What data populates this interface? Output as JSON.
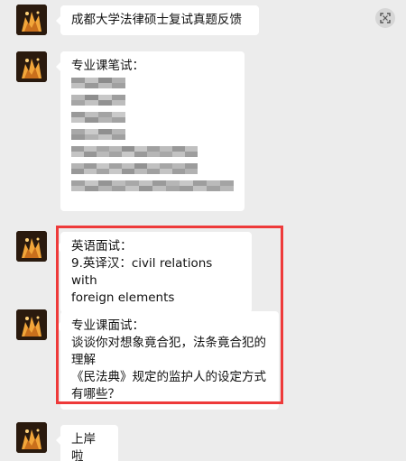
{
  "messages": [
    {
      "lines": [
        "成都大学法律硕士复试真题反馈"
      ]
    },
    {
      "lines": [
        "专业课笔试："
      ]
    },
    {
      "lines": [
        "英语面试：",
        "9.英译汉：civil relations with",
        "foreign elements"
      ]
    },
    {
      "lines": [
        "专业课面试：",
        "谈谈你对想象竟合犯，法条竟合犯的",
        "理解",
        "《民法典》规定的监护人的设定方式",
        "有哪些？"
      ]
    },
    {
      "lines": [
        "上岸啦"
      ]
    }
  ],
  "icons": {
    "avatar": "avatar-image",
    "expand": "expand-icon"
  },
  "colors": {
    "background": "#ececec",
    "bubble": "#ffffff",
    "highlight": "#ee3a3a",
    "avatar_bg": "#3b2414",
    "avatar_glow": "#f2a63a"
  }
}
